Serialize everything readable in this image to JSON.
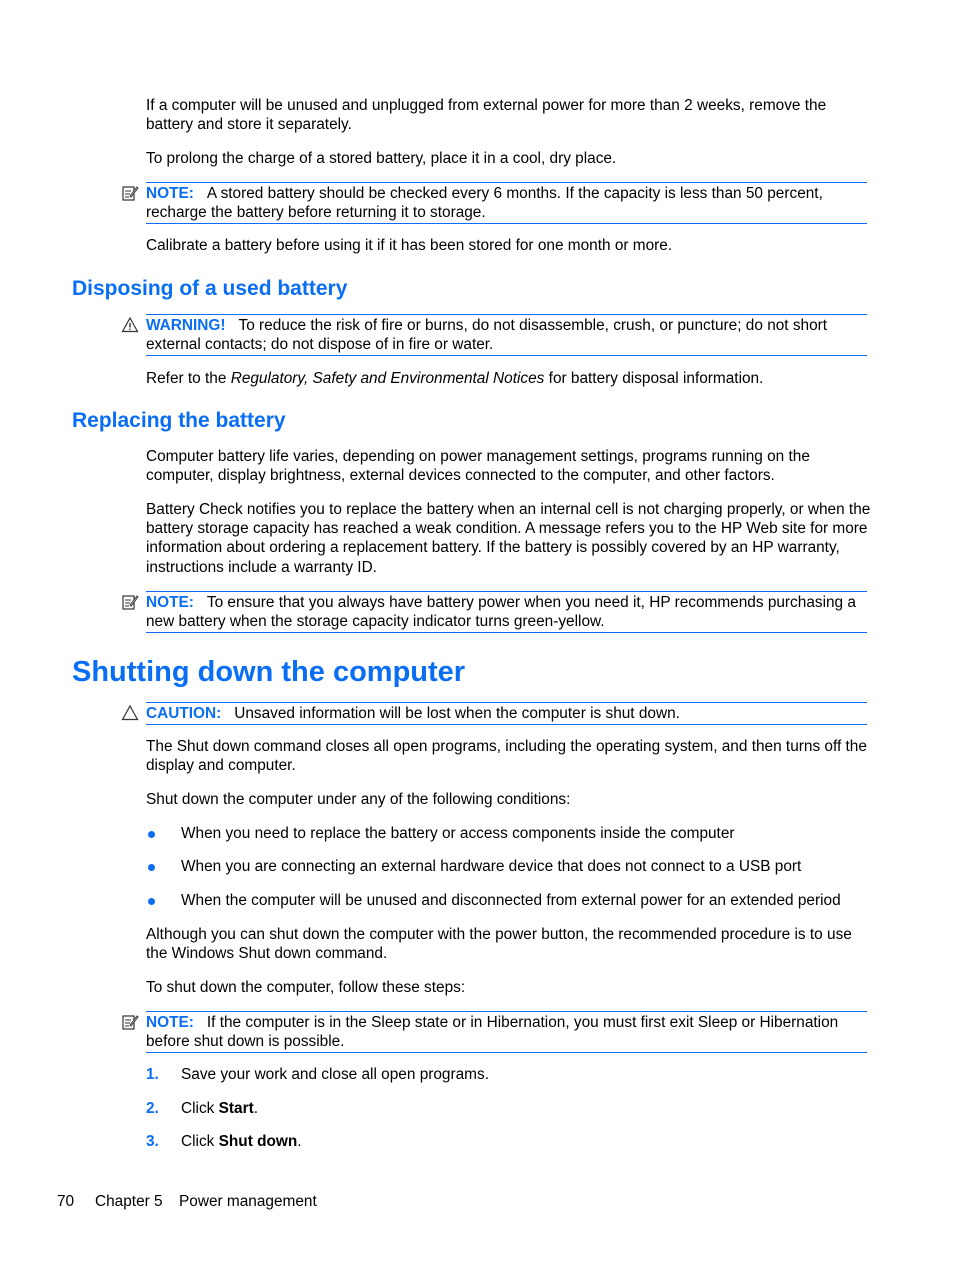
{
  "intro": {
    "p1": "If a computer will be unused and unplugged from external power for more than 2 weeks, remove the battery and store it separately.",
    "p2": "To prolong the charge of a stored battery, place it in a cool, dry place.",
    "note1": {
      "icon": "note-pencil-icon",
      "label": "NOTE:",
      "text": "A stored battery should be checked every 6 months. If the capacity is less than 50 percent, recharge the battery before returning it to storage."
    },
    "p3": "Calibrate a battery before using it if it has been stored for one month or more."
  },
  "disposing": {
    "heading": "Disposing of a used battery",
    "warning": {
      "icon": "warning-triangle-icon",
      "label": "WARNING!",
      "text": "To reduce the risk of fire or burns, do not disassemble, crush, or puncture; do not short external contacts; do not dispose of in fire or water."
    },
    "p1_before": "Refer to the ",
    "p1_italic": "Regulatory, Safety and Environmental Notices",
    "p1_after": " for battery disposal information."
  },
  "replacing": {
    "heading": "Replacing the battery",
    "p1": "Computer battery life varies, depending on power management settings, programs running on the computer, display brightness, external devices connected to the computer, and other factors.",
    "p2": "Battery Check notifies you to replace the battery when an internal cell is not charging properly, or when the battery storage capacity has reached a weak condition. A message refers you to the HP Web site for more information about ordering a replacement battery. If the battery is possibly covered by an HP warranty, instructions include a warranty ID.",
    "note": {
      "icon": "note-pencil-icon",
      "label": "NOTE:",
      "text": "To ensure that you always have battery power when you need it, HP recommends purchasing a new battery when the storage capacity indicator turns green-yellow."
    }
  },
  "shutting": {
    "heading": "Shutting down the computer",
    "caution": {
      "icon": "caution-triangle-icon",
      "label": "CAUTION:",
      "text": "Unsaved information will be lost when the computer is shut down."
    },
    "p1": "The Shut down command closes all open programs, including the operating system, and then turns off the display and computer.",
    "p2": "Shut down the computer under any of the following conditions:",
    "bullets": [
      "When you need to replace the battery or access components inside the computer",
      "When you are connecting an external hardware device that does not connect to a USB port",
      "When the computer will be unused and disconnected from external power for an extended period"
    ],
    "p3": "Although you can shut down the computer with the power button, the recommended procedure is to use the Windows Shut down command.",
    "p4": "To shut down the computer, follow these steps:",
    "note": {
      "icon": "note-pencil-icon",
      "label": "NOTE:",
      "text": "If the computer is in the Sleep state or in Hibernation, you must first exit Sleep or Hibernation before shut down is possible."
    },
    "steps": [
      {
        "num": "1.",
        "before": "Save your work and close all open programs.",
        "bold": "",
        "after": ""
      },
      {
        "num": "2.",
        "before": "Click ",
        "bold": "Start",
        "after": "."
      },
      {
        "num": "3.",
        "before": "Click ",
        "bold": "Shut down",
        "after": "."
      }
    ]
  },
  "footer": {
    "page_number": "70",
    "chapter": "Chapter 5",
    "chapter_title": "Power management"
  },
  "colors": {
    "accent": "#0a6ef5",
    "text": "#000000"
  }
}
